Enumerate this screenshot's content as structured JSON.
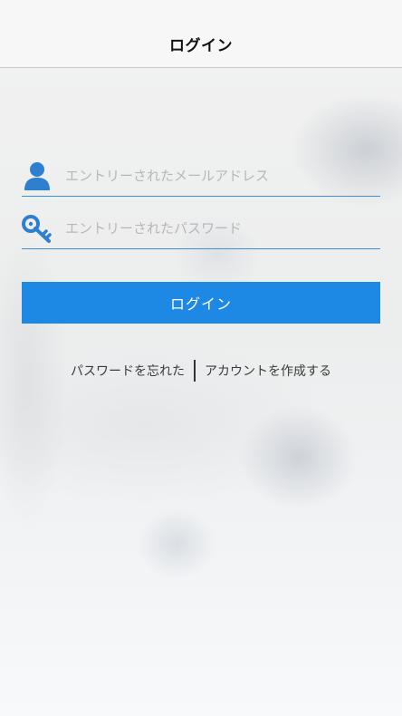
{
  "header": {
    "title": "ログイン"
  },
  "form": {
    "email": {
      "placeholder": "エントリーされたメールアドレス",
      "value": "",
      "icon": "user-icon"
    },
    "password": {
      "placeholder": "エントリーされたパスワード",
      "value": "",
      "icon": "key-icon"
    },
    "login_label": "ログイン"
  },
  "links": {
    "forgot_password": "パスワードを忘れた",
    "create_account": "アカウントを作成する"
  },
  "colors": {
    "accent": "#1e88e5",
    "underline": "#3f8fd6",
    "icon": "#2f7fd1",
    "placeholder": "#b4b8bd"
  }
}
